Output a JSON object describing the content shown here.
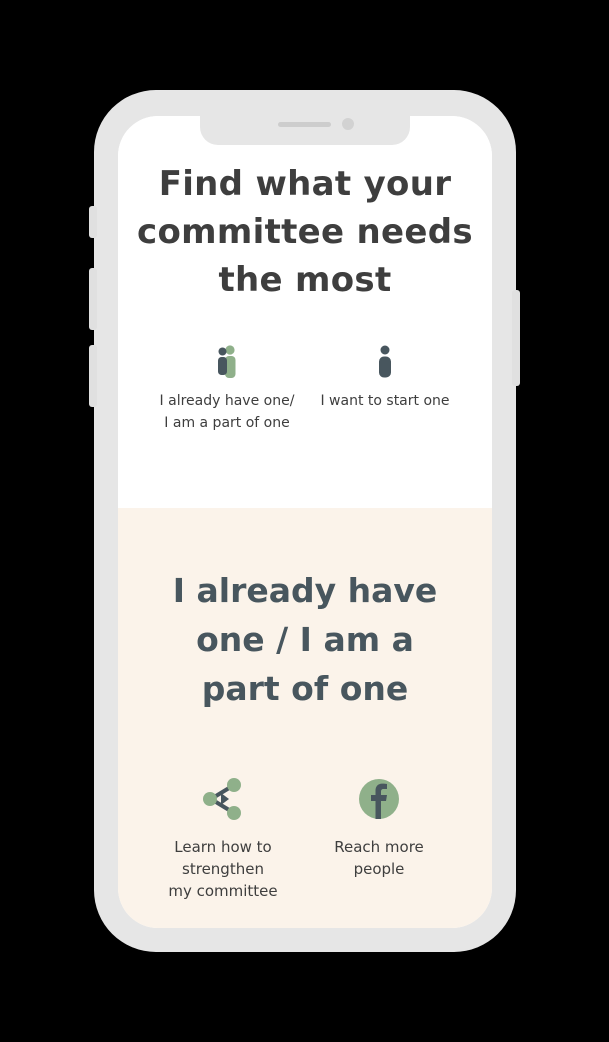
{
  "colors": {
    "background": "#000000",
    "phone_frame": "#e6e6e6",
    "screen_top": "#ffffff",
    "screen_bottom": "#fbf3ea",
    "heading_dark": "#3e3e3e",
    "heading_slate": "#48565e",
    "icon_green": "#8fb08a",
    "icon_slate": "#48565e"
  },
  "top_section": {
    "title": "Find what your committee needs the most",
    "choices": [
      {
        "label": "I already have one/\nI am a part of one",
        "icon": "group-people-icon"
      },
      {
        "label": "I want to start one",
        "icon": "single-person-icon"
      }
    ]
  },
  "bottom_section": {
    "title": "I already have\none / I am a\npart of one",
    "features": [
      {
        "label": "Learn how to\nstrengthen\nmy committee",
        "icon": "network-share-icon"
      },
      {
        "label": "Reach more\npeople",
        "icon": "facebook-icon"
      }
    ]
  }
}
